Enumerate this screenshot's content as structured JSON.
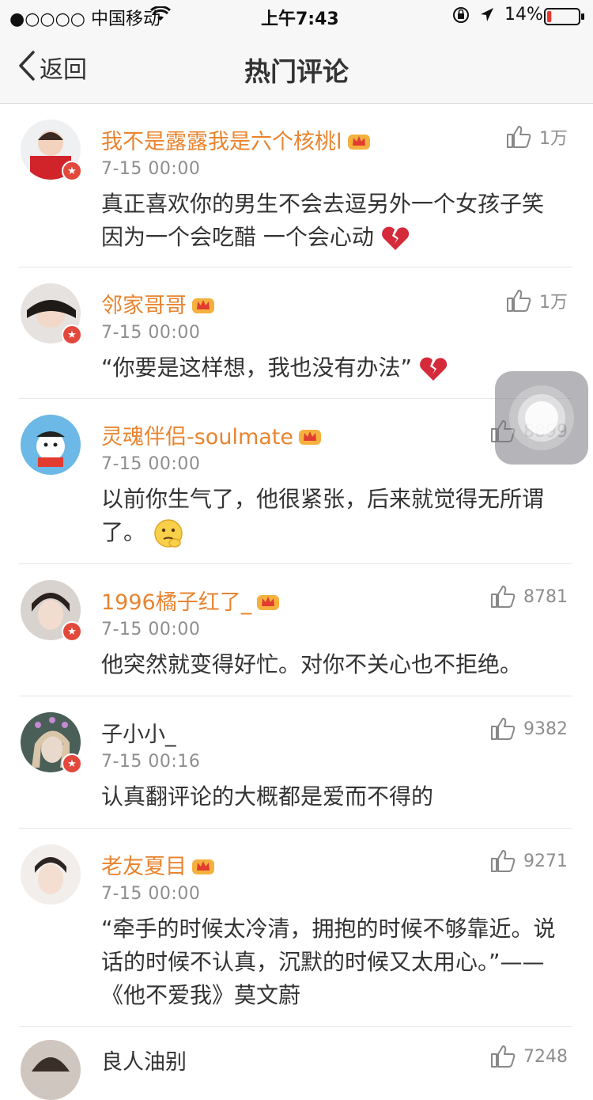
{
  "status_bar": {
    "carrier": "●○○○○ 中国移动",
    "time": "上午7:43",
    "battery": "14%",
    "battery_level": 0.14
  },
  "nav": {
    "back_label": "返回",
    "title": "热门评论"
  },
  "colors": {
    "vip_name": "#e9842f",
    "badge_red": "#e2483c",
    "meta_gray": "#8e8e8e"
  },
  "comments": [
    {
      "username": "我不是露露我是六个核桃l",
      "vip": true,
      "time": "7-15 00:00",
      "likes": "1万",
      "text": "真正喜欢你的男生不会去逗另外一个女孩子笑 因为一个会吃醋 一个会心动",
      "emoji": "broken-heart"
    },
    {
      "username": "邻家哥哥",
      "vip": true,
      "time": "7-15 00:00",
      "likes": "1万",
      "text": "“你要是这样想，我也没有办法”",
      "emoji": "broken-heart"
    },
    {
      "username": "灵魂伴侣-soulmate",
      "vip": true,
      "time": "7-15 00:00",
      "likes": "8899",
      "text": "以前你生气了，他很紧张，后来就觉得无所谓了。",
      "emoji": "thinking-face"
    },
    {
      "username": "1996橘子红了_",
      "vip": true,
      "time": "7-15 00:00",
      "likes": "8781",
      "text": "他突然就变得好忙。对你不关心也不拒绝。",
      "emoji": ""
    },
    {
      "username": "子小小_",
      "vip": false,
      "time": "7-15 00:16",
      "likes": "9382",
      "text": "认真翻评论的大概都是爱而不得的",
      "emoji": ""
    },
    {
      "username": "老友夏目",
      "vip": true,
      "time": "7-15 00:00",
      "likes": "9271",
      "text": "“牵手的时候太冷清，拥抱的时候不够靠近。说话的时候不认真，沉默的时候又太用心。”——《他不爱我》莫文蔚",
      "emoji": ""
    },
    {
      "username": "良人油别",
      "vip": false,
      "time": "",
      "likes": "7248",
      "text": "",
      "emoji": ""
    }
  ]
}
